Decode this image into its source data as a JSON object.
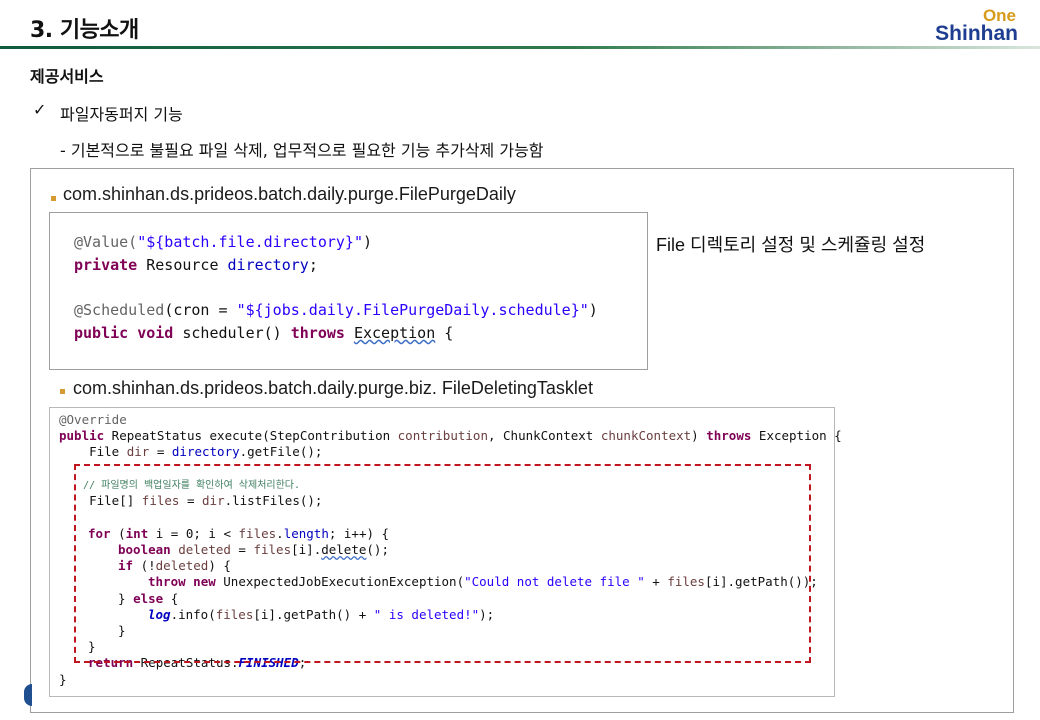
{
  "header": {
    "title": "3. 기능소개",
    "logo_top": "One",
    "logo_bottom": "Shinhan"
  },
  "section": {
    "title": "제공서비스",
    "check_icon": "✓",
    "check_label": "파일자동퍼지 기능",
    "description": "- 기본적으로 불필요 파일 삭제, 업무적으로 필요한 기능 추가삭제 가능함"
  },
  "class1": {
    "name": "com.shinhan.ds.prideos.batch.daily.purge.FilePurgeDaily",
    "note": "File 디렉토리 설정 및 스케쥴링 설정",
    "code": {
      "l1_ann": "@Value(",
      "l1_str": "\"${batch.file.directory}\"",
      "l1_end": ")",
      "l2_kw": "private",
      "l2_type": " Resource ",
      "l2_fld": "directory",
      "l2_end": ";",
      "l3_ann": "@Scheduled",
      "l3_mid": "(cron = ",
      "l3_str": "\"${jobs.daily.FilePurgeDaily.schedule}\"",
      "l3_end": ")",
      "l4_kw1": "public",
      "l4_kw2": "void",
      "l4_mid": " scheduler() ",
      "l4_kw3": "throws",
      "l4_exc": "Exception",
      "l4_end": " {"
    }
  },
  "class2": {
    "name": "com.shinhan.ds.prideos.batch.daily.purge.biz. FileDeletingTasklet",
    "code": {
      "override": "@Override",
      "sig_kw": "public",
      "sig_mid": " RepeatStatus execute(StepContribution ",
      "sig_p1": "contribution",
      "sig_mid2": ", ChunkContext ",
      "sig_p2": "chunkContext",
      "sig_mid3": ") ",
      "sig_throws": "throws",
      "sig_end": " Exception {",
      "file_a": "    File ",
      "file_dir": "dir",
      "file_b": " = ",
      "file_fld": "directory",
      "file_c": ".getFile();",
      "comment": "    // 파일명의 백업일자를 확인하여 삭제처리한다.",
      "files_a": "    File[] ",
      "files_v": "files",
      "files_b": " = ",
      "files_dir": "dir",
      "files_c": ".listFiles();",
      "for_kw": "for",
      "for_a": " (",
      "for_int": "int",
      "for_b": " i = 0; i < ",
      "for_files": "files",
      "for_c": ".",
      "for_len": "length",
      "for_d": "; i++) {",
      "bool_kw": "boolean",
      "bool_v": " deleted",
      "bool_a": " = ",
      "bool_files": "files",
      "bool_b": "[i].",
      "bool_del": "delete",
      "bool_c": "();",
      "if_kw": "if",
      "if_a": " (!",
      "if_v": "deleted",
      "if_b": ") {",
      "throw_kw": "throw",
      "new_kw": "new",
      "throw_a": " UnexpectedJobExecutionException(",
      "throw_str": "\"Could not delete file \"",
      "throw_b": " + ",
      "throw_files": "files",
      "throw_c": "[i].getPath());",
      "else_a": "} ",
      "else_kw": "else",
      "else_b": " {",
      "log_v": "log",
      "log_a": ".info(",
      "log_files": "files",
      "log_b": "[i].getPath() + ",
      "log_str": "\" is deleted!\"",
      "log_c": ");",
      "close_inner": "}",
      "close_for": "}",
      "ret_kw": "return",
      "ret_a": " RepeatStatus.",
      "ret_const": "FINISHED",
      "ret_b": ";",
      "close_method": "}"
    }
  }
}
